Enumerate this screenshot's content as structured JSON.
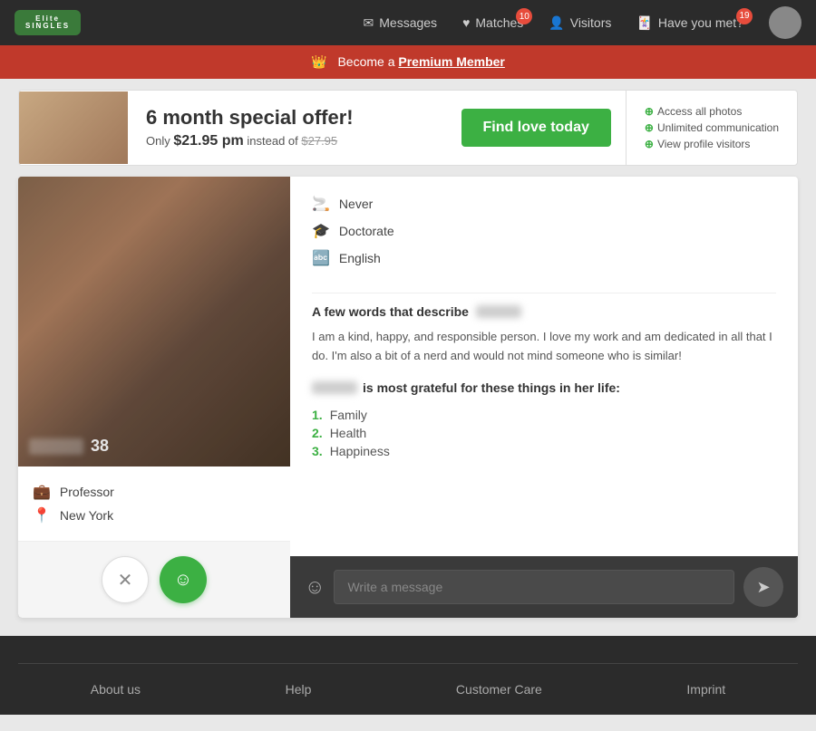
{
  "header": {
    "logo_text": "Elite",
    "logo_sub": "SINGLES",
    "nav": {
      "messages_label": "Messages",
      "matches_label": "Matches",
      "matches_badge": "10",
      "visitors_label": "Visitors",
      "haveyoumet_label": "Have you met?",
      "haveyoumet_badge": "19"
    }
  },
  "premium_banner": {
    "text": "Become a",
    "link_text": "Premium Member"
  },
  "ad": {
    "title": "6 month special offer!",
    "subtitle_pre": "Only",
    "price": "$21.95 pm",
    "subtitle_post": "instead of",
    "old_price": "$27.95",
    "cta_label": "Find love today",
    "features": [
      "Access all photos",
      "Unlimited communication",
      "View profile visitors"
    ]
  },
  "profile": {
    "age": "38",
    "job": "Professor",
    "location": "New York",
    "attributes": [
      {
        "icon": "cigarette",
        "value": "Never"
      },
      {
        "icon": "graduation",
        "value": "Doctorate"
      },
      {
        "icon": "language",
        "value": "English"
      }
    ],
    "describe_label": "A few words that describe",
    "bio": "I am a kind, happy, and responsible person. I love my work and am dedicated in all that I do. I'm also a bit of a nerd and would not mind someone who is similar!",
    "grateful_label": "is most grateful for these things in her life:",
    "grateful_items": [
      "Family",
      "Health",
      "Happiness"
    ]
  },
  "message": {
    "placeholder": "Write a message"
  },
  "footer": {
    "links": [
      "About us",
      "Help",
      "Customer Care",
      "Imprint"
    ]
  }
}
